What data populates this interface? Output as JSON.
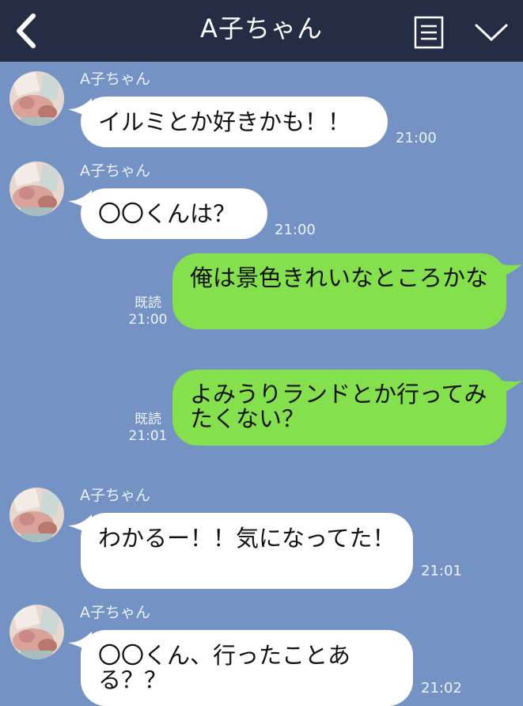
{
  "header": {
    "title": "A子ちゃん",
    "back_icon": "chevron-left-icon",
    "menu_icon": "list-icon",
    "collapse_icon": "chevron-down-icon",
    "background": "#252d44"
  },
  "colors": {
    "chat_background": "#7493c4",
    "incoming_bubble": "#ffffff",
    "outgoing_bubble": "#84e04c"
  },
  "messages": [
    {
      "direction": "in",
      "sender": "A子ちゃん",
      "text": "イルミとか好きかも！！",
      "time": "21:00"
    },
    {
      "direction": "in",
      "sender": "A子ちゃん",
      "text": "〇〇くんは？",
      "time": "21:00"
    },
    {
      "direction": "out",
      "text": "俺は景色きれいなところかな",
      "read": "既読",
      "time": "21:00"
    },
    {
      "direction": "out",
      "text": "よみうりランドとか行ってみたくない？",
      "read": "既読",
      "time": "21:01"
    },
    {
      "direction": "in",
      "sender": "A子ちゃん",
      "text": "わかるー！！気になってた！",
      "time": "21:01"
    },
    {
      "direction": "in",
      "sender": "A子ちゃん",
      "text": "〇〇くん、行ったことある？？",
      "time": "21:02"
    }
  ]
}
